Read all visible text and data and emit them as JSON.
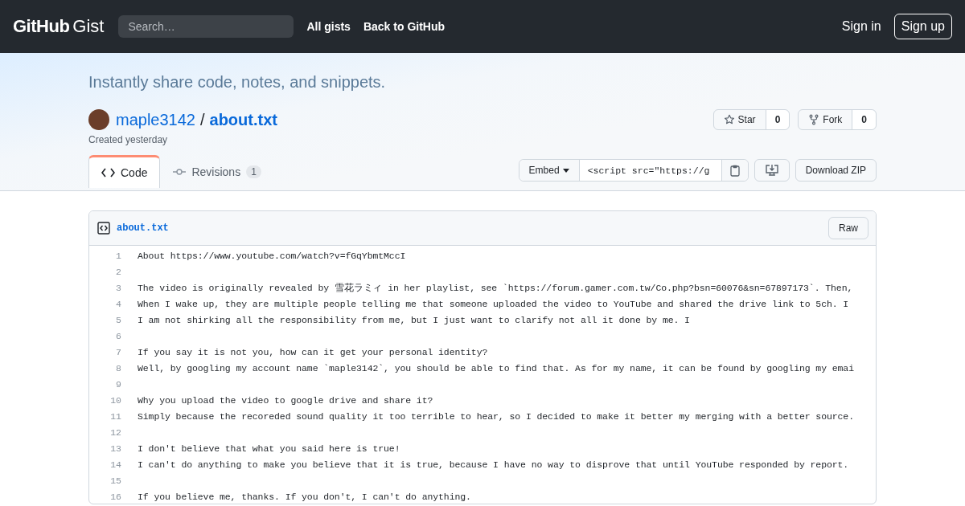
{
  "header": {
    "logo_bold": "GitHub",
    "logo_light": "Gist",
    "search": {
      "placeholder": "Search…"
    },
    "nav": [
      "All gists",
      "Back to GitHub"
    ],
    "sign_in": "Sign in",
    "sign_up": "Sign up"
  },
  "tagline": "Instantly share code, notes, and snippets.",
  "gist": {
    "owner": "maple3142",
    "separator": "/",
    "filename": "about.txt",
    "created": "Created yesterday"
  },
  "social": [
    {
      "kind": "star",
      "label": "Star",
      "count": "0"
    },
    {
      "kind": "fork",
      "label": "Fork",
      "count": "0"
    }
  ],
  "tabs": [
    {
      "kind": "code",
      "label": "Code",
      "selected": true
    },
    {
      "kind": "revisions",
      "label": "Revisions",
      "count": "1",
      "selected": false
    }
  ],
  "embed": {
    "label": "Embed",
    "value": "<script src=\"https://g"
  },
  "download": "Download ZIP",
  "file": {
    "name": "about.txt",
    "raw": "Raw",
    "lines": [
      {
        "number": "1",
        "text": "About https://www.youtube.com/watch?v=fGqYbmtMccI"
      },
      {
        "number": "2"
      },
      {
        "number": "3",
        "text": "The video is originally revealed by 雪花ラミィ in her playlist, see `https://forum.gamer.com.tw/Co.php?bsn=60076&sn=67897173`. Then,"
      },
      {
        "number": "4",
        "text": "When I wake up, they are multiple people telling me that someone uploaded the video to YouTube and shared the drive link to 5ch. I"
      },
      {
        "number": "5",
        "text": "I am not shirking all the responsibility from me, but I just want to clarify not all it done by me. I"
      },
      {
        "number": "6"
      },
      {
        "number": "7",
        "text": "If you say it is not you, how can it get your personal identity?"
      },
      {
        "number": "8",
        "text": "Well, by googling my account name `maple3142`, you should be able to find that. As for my name, it can be found by googling my emai"
      },
      {
        "number": "9"
      },
      {
        "number": "10",
        "text": "Why you upload the video to google drive and share it?"
      },
      {
        "number": "11",
        "text": "Simply because the recoreded sound quality it too terrible to hear, so I decided to make it better my merging with a better source."
      },
      {
        "number": "12"
      },
      {
        "number": "13",
        "text": "I don't believe that what you said here is true!"
      },
      {
        "number": "14",
        "text": "I can't do anything to make you believe that it is true, because I have no way to disprove that until YouTube responded by report."
      },
      {
        "number": "15"
      },
      {
        "number": "16",
        "text": "If you believe me, thanks. If you don't, I can't do anything."
      }
    ]
  }
}
